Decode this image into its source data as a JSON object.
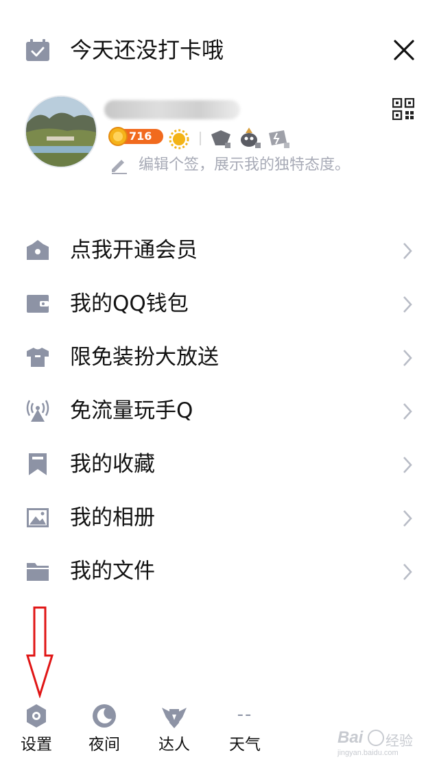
{
  "header": {
    "checkin_text": "今天还没打卡哦",
    "close_icon": "close-icon",
    "calendar_icon": "calendar-check-icon"
  },
  "profile": {
    "level_number": "716",
    "signature": "编辑个签，展示我的独特态度。",
    "qr_icon": "qr-code-icon",
    "edit_icon": "pencil-icon"
  },
  "menu": {
    "items": [
      {
        "label": "点我开通会员",
        "icon": "crown-icon"
      },
      {
        "label": "我的QQ钱包",
        "icon": "wallet-icon"
      },
      {
        "label": "限免装扮大放送",
        "icon": "shirt-icon"
      },
      {
        "label": "免流量玩手Q",
        "icon": "signal-tower-icon"
      },
      {
        "label": "我的收藏",
        "icon": "bookmark-icon"
      },
      {
        "label": "我的相册",
        "icon": "photo-icon"
      },
      {
        "label": "我的文件",
        "icon": "folder-icon"
      }
    ]
  },
  "bottom": {
    "settings_label": "设置",
    "night_label": "夜间",
    "expert_label": "达人",
    "weather_label": "天气",
    "weather_value": "--"
  },
  "watermark": {
    "brand": "Bai",
    "brand_cn": "经验",
    "url": "jingyan.baidu.com"
  },
  "colors": {
    "icon_gray": "#8d93a5",
    "text": "#111111",
    "chevron": "#b8bcc6",
    "annotation_red": "#e01515",
    "level_orange": "#f16a1e"
  }
}
